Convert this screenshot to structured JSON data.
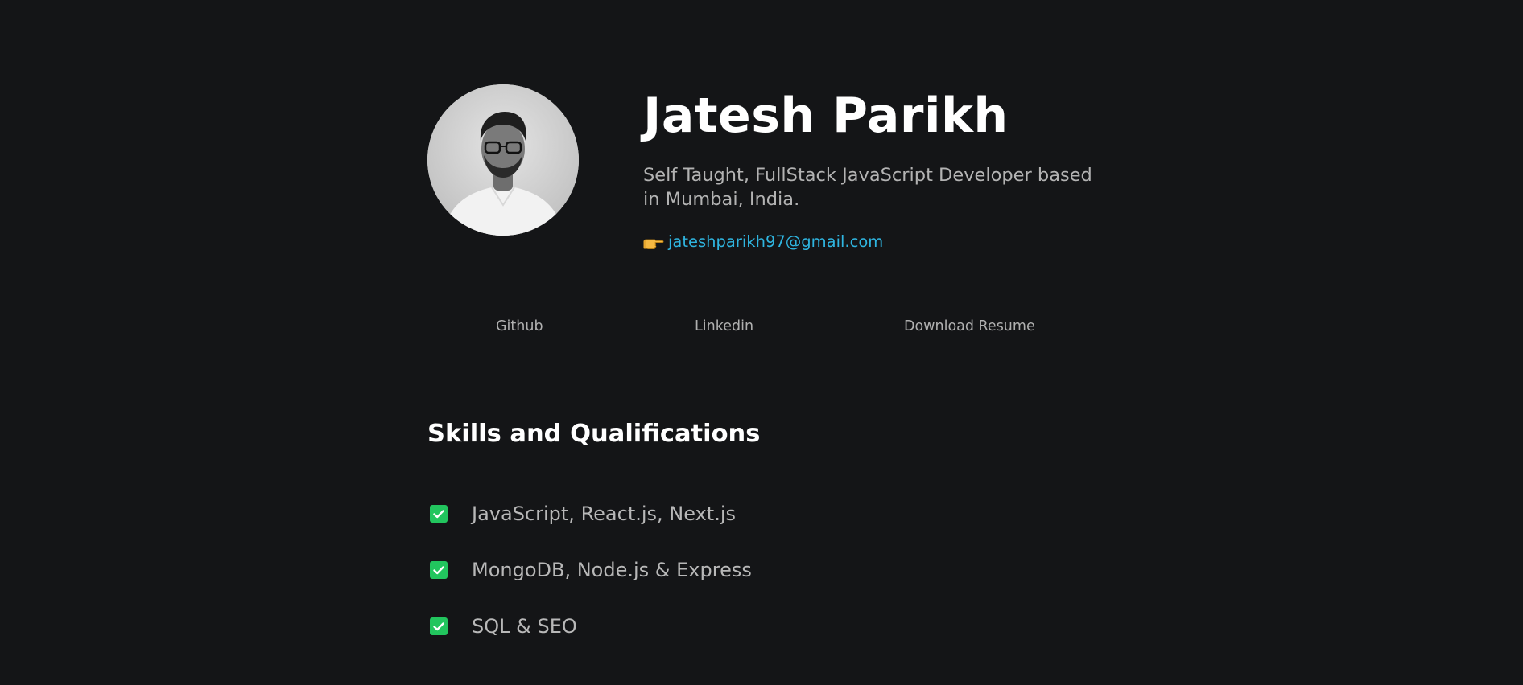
{
  "profile": {
    "name": "Jatesh Parikh",
    "tagline": "Self Taught, FullStack JavaScript Developer based in Mumbai, India.",
    "email": "jateshparikh97@gmail.com",
    "email_icon": "pointing-hand-icon",
    "avatar_icon": "profile-photo"
  },
  "links": {
    "github": "Github",
    "linkedin": "Linkedin",
    "resume": "Download Resume"
  },
  "skills": {
    "title": "Skills and Qualifications",
    "check_icon": "checkbox-checked-icon",
    "items": [
      "JavaScript, React.js, Next.js",
      "MongoDB, Node.js & Express",
      "SQL & SEO"
    ]
  },
  "colors": {
    "background": "#141517",
    "accent_link": "#2fb5e0",
    "check_green": "#22c55e",
    "heading": "#ffffff",
    "muted_text": "#b3b3b3"
  }
}
